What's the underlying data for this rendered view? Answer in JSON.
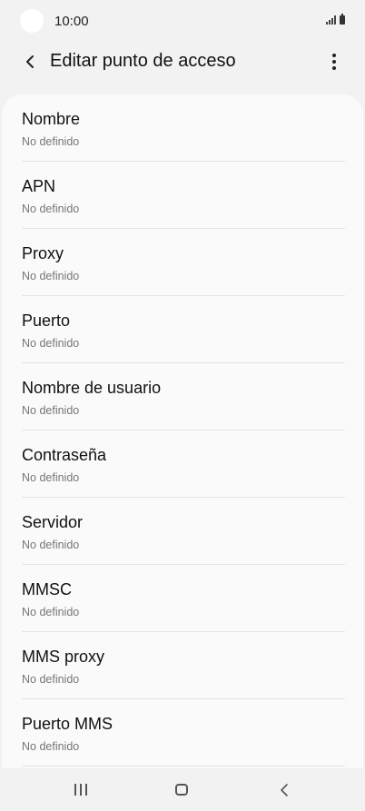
{
  "status_bar": {
    "time": "10:00"
  },
  "header": {
    "title": "Editar punto de acceso",
    "back_icon": "chevron-left-icon",
    "more_icon": "more-vertical-icon"
  },
  "fields": [
    {
      "label": "Nombre",
      "value": "No definido"
    },
    {
      "label": "APN",
      "value": "No definido"
    },
    {
      "label": "Proxy",
      "value": "No definido"
    },
    {
      "label": "Puerto",
      "value": "No definido"
    },
    {
      "label": "Nombre de usuario",
      "value": "No definido"
    },
    {
      "label": "Contraseña",
      "value": "No definido"
    },
    {
      "label": "Servidor",
      "value": "No definido"
    },
    {
      "label": "MMSC",
      "value": "No definido"
    },
    {
      "label": "MMS proxy",
      "value": "No definido"
    },
    {
      "label": "Puerto MMS",
      "value": "No definido"
    }
  ],
  "nav_bar": {
    "recents_icon": "recents-icon",
    "home_icon": "home-icon",
    "back_icon": "back-icon"
  }
}
